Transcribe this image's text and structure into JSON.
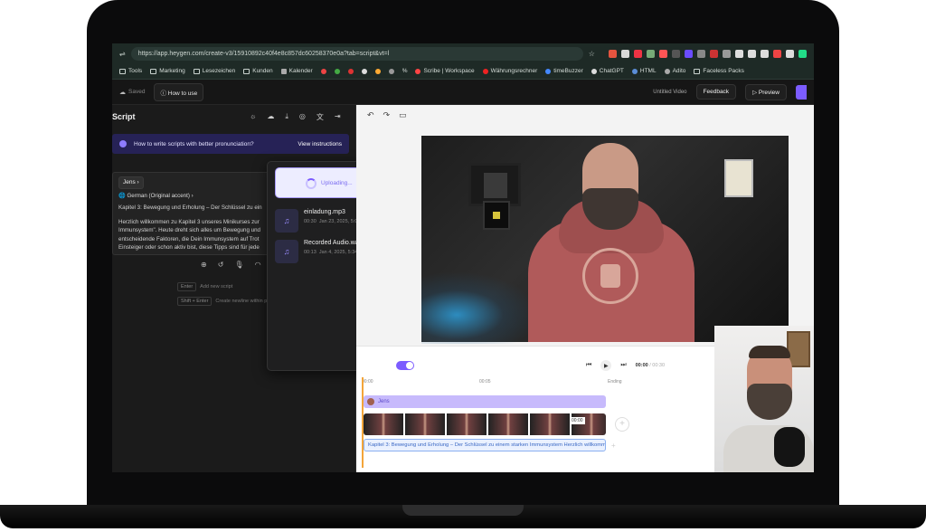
{
  "browser": {
    "url": "https://app.heygen.com/create-v3/15910892c40f4e8c857dc60258370e0a?tab=script&vt=l",
    "bookmarks": [
      "Tools",
      "Marketing",
      "Lesezeichen",
      "Kunden",
      "Kalender",
      "%",
      "Scribe | Workspace",
      "Währungsrechner",
      "timeBuzzer",
      "ChatGPT",
      "HTML",
      "Adito",
      "Faceless Packs"
    ]
  },
  "app": {
    "saved": "Saved",
    "how_to_use": "How to use",
    "untitled": "Untitled Video",
    "feedback": "Feedback",
    "preview": "Preview"
  },
  "script_panel": {
    "title": "Script",
    "tip": "How to write scripts with better pronunciation?",
    "tip_link": "View instructions",
    "speaker": "Jens",
    "accent": "German (Original accent)",
    "line1": "Kapitel 3: Bewegung und Erholung – Der Schlüssel zu ein",
    "line2": "Herzlich willkommen zu Kapitel 3 unseres Minikurses zur",
    "line3": "Immunsystem\". Heute dreht sich alles um Bewegung und",
    "line4": "entscheidende Faktoren, die Dein Immunsystem auf Trot",
    "line5": "Einsteiger oder schon aktiv bist, diese Tipps sind für jede",
    "hint1_key": "Enter",
    "hint1": "Add new script",
    "hint2_key": "Shift + Enter",
    "hint2": "Create newline within pa"
  },
  "upload": {
    "status": "Uploading...",
    "files": [
      {
        "name": "einladung.mp3",
        "duration": "00:30",
        "date": "Jan 23, 2025, 5:01 PM"
      },
      {
        "name": "Recorded Audio.wav",
        "duration": "00:13",
        "date": "Jan 4, 2025, 5:34 PM"
      }
    ]
  },
  "timeline": {
    "time_current": "00:00",
    "time_total": "/ 00:30",
    "tick0": "00:00",
    "tick1": "00:05",
    "tick2": "Ending",
    "avatar_track": "Jens",
    "thumb_time": "00:00",
    "script_track": "Kapitel 3: Bewegung und Erholung – Der Schlüssel zu einem starken Immunsystem Herzlich willkomm..."
  }
}
